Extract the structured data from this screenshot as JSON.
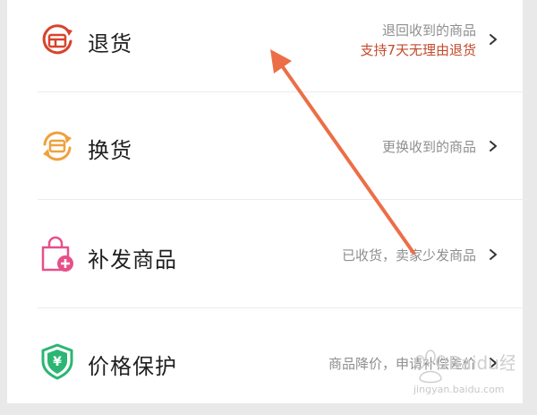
{
  "menu": {
    "items": [
      {
        "id": "return",
        "title": "退货",
        "desc": "退回收到的商品",
        "desc2": "支持7天无理由退货",
        "icon": "return-goods-icon",
        "icon_color": "#d9432b"
      },
      {
        "id": "exchange",
        "title": "换货",
        "desc": "更换收到的商品",
        "icon": "exchange-goods-icon",
        "icon_color": "#f0a03c"
      },
      {
        "id": "resend",
        "title": "补发商品",
        "desc": "已收货，卖家少发商品",
        "icon": "resend-bag-icon",
        "icon_color": "#e6508a"
      },
      {
        "id": "price",
        "title": "价格保护",
        "desc": "商品降价，申请补偿差价",
        "icon": "price-protect-shield-icon",
        "icon_color": "#2bb673"
      }
    ]
  },
  "overlay": {
    "annotation": "arrow-pointing-to-return",
    "color": "#ec6e46"
  },
  "watermark": {
    "brand": "Baidu经验",
    "url": "jingyan.baidu.com"
  }
}
